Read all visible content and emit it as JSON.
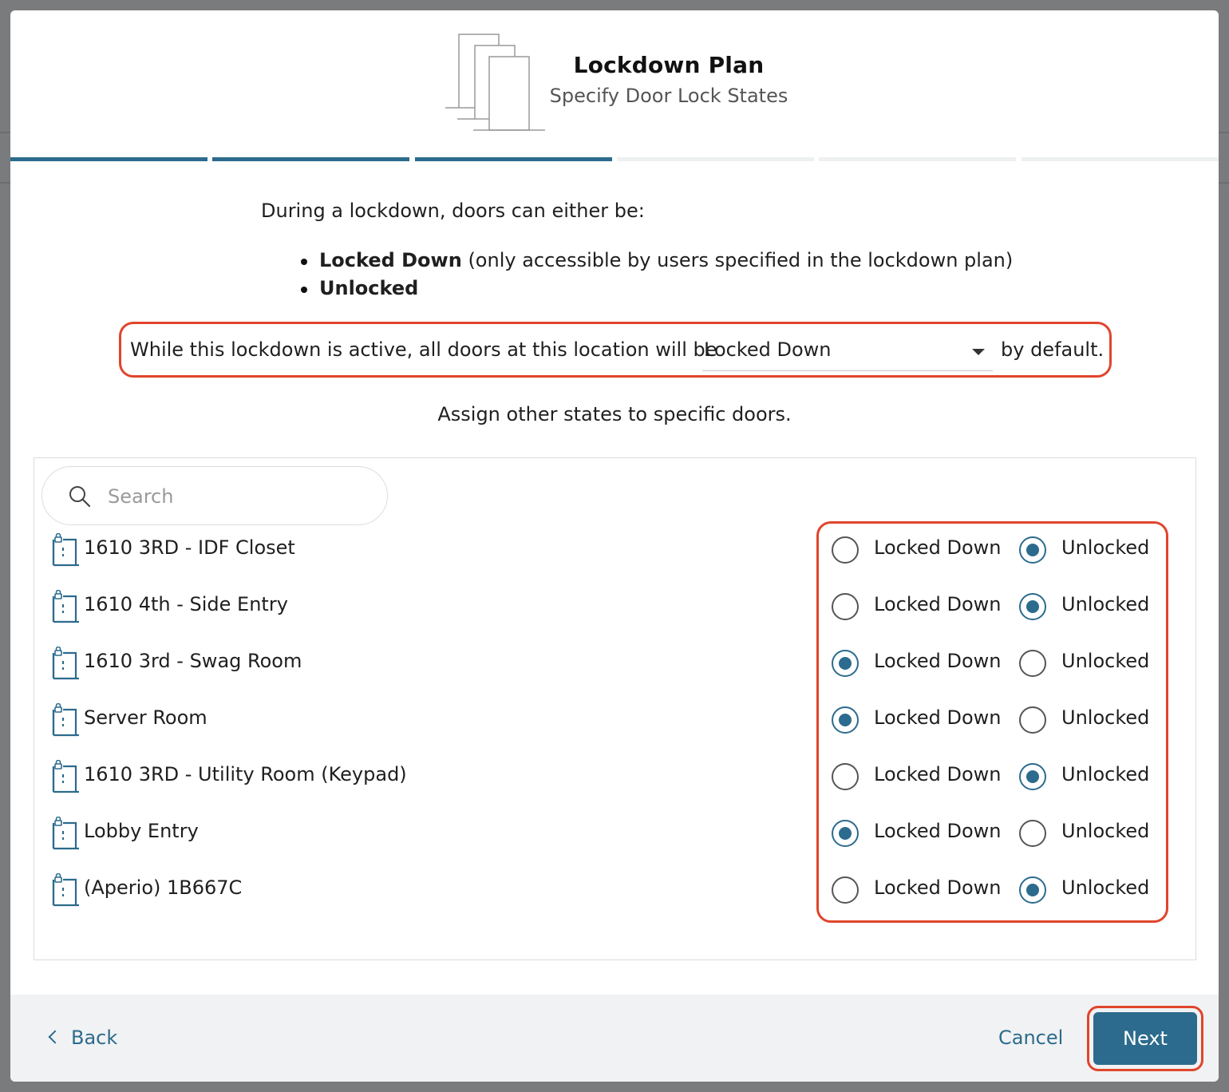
{
  "header": {
    "title": "Lockdown Plan",
    "subtitle": "Specify Door Lock States",
    "icon": "documents-stack-icon"
  },
  "progress": {
    "total_steps": 6,
    "completed_steps": 3,
    "accent_color": "#2c6b8d"
  },
  "intro": {
    "text": "During a lockdown, doors can either be:",
    "states": [
      {
        "name": "Locked Down",
        "description": " (only accessible by users specified in the lockdown plan)"
      },
      {
        "name": "Unlocked",
        "description": ""
      }
    ]
  },
  "default_state": {
    "prefix": "While this lockdown is active, all doors at this location will be",
    "selected": "Locked Down",
    "suffix": "by default."
  },
  "assign_text": "Assign other states to specific doors.",
  "search": {
    "placeholder": "Search",
    "value": ""
  },
  "option_labels": {
    "locked": "Locked Down",
    "unlocked": "Unlocked"
  },
  "doors": [
    {
      "name": "1610 3RD - IDF Closet",
      "state": "Unlocked"
    },
    {
      "name": "1610 4th - Side Entry",
      "state": "Unlocked"
    },
    {
      "name": "1610 3rd - Swag Room",
      "state": "Locked Down"
    },
    {
      "name": "Server Room",
      "state": "Locked Down"
    },
    {
      "name": "1610 3RD - Utility Room (Keypad)",
      "state": "Unlocked"
    },
    {
      "name": "Lobby Entry",
      "state": "Locked Down"
    },
    {
      "name": "(Aperio) 1B667C",
      "state": "Unlocked"
    }
  ],
  "footer": {
    "back_label": "Back",
    "cancel_label": "Cancel",
    "next_label": "Next"
  },
  "colors": {
    "accent": "#2c6b8d",
    "highlight": "#e0452c"
  }
}
